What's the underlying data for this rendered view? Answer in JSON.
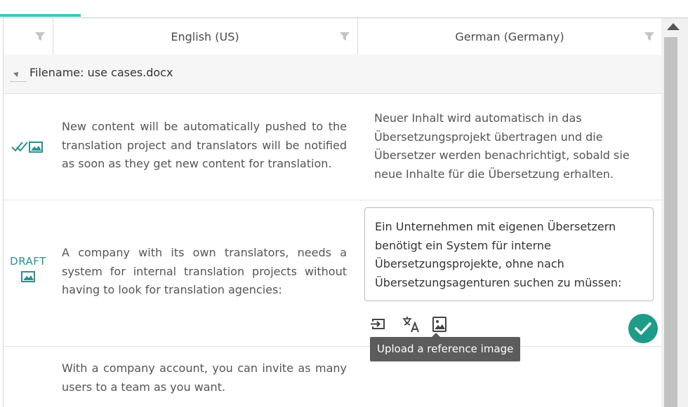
{
  "header": {
    "source_lang": "English (US)",
    "target_lang": "German (Germany)"
  },
  "group": {
    "label": "Filename: use cases.docx"
  },
  "rows": [
    {
      "status": "confirmed",
      "source": "New content will be automatically pushed to the translation project and translators will be notified as soon as they get new content for translation.",
      "target": "Neuer Inhalt wird automatisch in das Übersetzungsprojekt übertragen und die Übersetzer werden benachrichtigt, sobald sie neue Inhalte für die Übersetzung erhalten."
    },
    {
      "status": "DRAFT",
      "source": "A company with its own translators, needs a system for internal translation projects without having to look for translation agencies:",
      "target": "Ein Unternehmen mit eigenen Übersetzern benötigt ein System für interne Übersetzungsprojekte, ohne nach Übersetzungsagenturen suchen zu müssen:"
    },
    {
      "status": "",
      "source": "With a company account, you can invite as many users to a team as you want.",
      "target": ""
    }
  ],
  "editor_tools": {
    "tooltip": "Upload a reference image",
    "icons": [
      "copy-source-icon",
      "translate-icon",
      "upload-image-icon",
      "confirm-check-icon"
    ]
  },
  "colors": {
    "accent": "#3fc7c0",
    "confirm": "#1f9b8a",
    "draft": "#2d8f8f"
  }
}
